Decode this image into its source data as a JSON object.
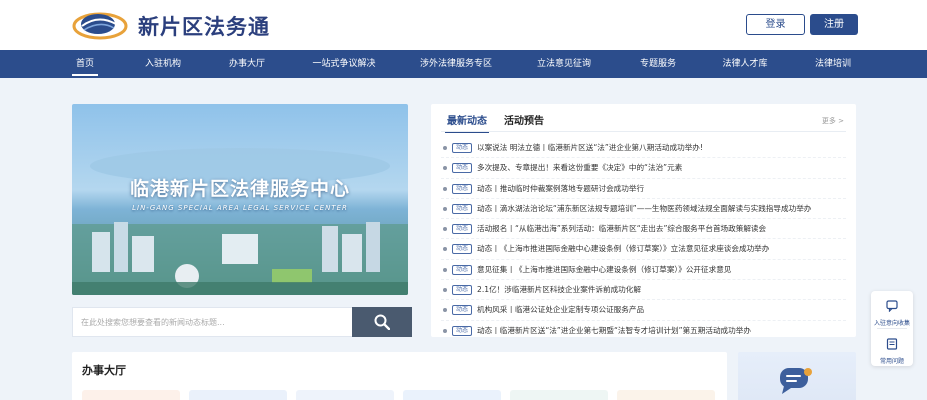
{
  "header": {
    "site_title": "新片区法务通",
    "login_label": "登录",
    "register_label": "注册"
  },
  "nav": {
    "items": [
      {
        "label": "首页",
        "active": true
      },
      {
        "label": "入驻机构"
      },
      {
        "label": "办事大厅"
      },
      {
        "label": "一站式争议解决"
      },
      {
        "label": "涉外法律服务专区"
      },
      {
        "label": "立法意见征询"
      },
      {
        "label": "专题服务"
      },
      {
        "label": "法律人才库"
      },
      {
        "label": "法律培训"
      }
    ]
  },
  "banner": {
    "title": "临港新片区法律服务中心",
    "subtitle": "LIN-GANG SPECIAL AREA LEGAL SERVICE CENTER"
  },
  "search": {
    "placeholder": "在此处搜索您想要查看的新闻动态标题..."
  },
  "news": {
    "tab_latest": "最新动态",
    "tab_preview": "活动预告",
    "more": "更多 >",
    "tag": "动态",
    "items": [
      "以案说法 明法立德丨临港新片区送“法”进企业第八期活动成功举办!",
      "多次提及、专章提出！来看这份重要《决定》中的“法治”元素",
      "动态丨推动临时仲裁案例落地专题研讨会成功举行",
      "动态丨滴水湖法治论坛“浦东新区法规专题培训”——生物医药领域法规全面解读与实践指导成功举办",
      "活动报名丨“从临港出海”系列活动：临港新片区“走出去”综合服务平台首场政策解读会",
      "动态丨《上海市推进国际金融中心建设条例（修订草案）》立法意见征求座谈会成功举办",
      "意见征集丨《上海市推进国际金融中心建设条例（修订草案）》公开征求意见",
      "2.1亿！涉临港新片区科技企业案件诉前成功化解",
      "机构风采丨临港公证处企业定制专项公证服务产品",
      "动态丨临港新片区送“法”进企业第七期暨“法智专才培训计划”第五期活动成功举办"
    ]
  },
  "float": {
    "consult_label": "入驻意向收集",
    "faq_label": "常用问题"
  },
  "hall": {
    "title": "办事大厅"
  },
  "colors": {
    "brand": "#2c4d8c",
    "title": "#2b3f7d",
    "search_button": "#4a5a6f"
  }
}
